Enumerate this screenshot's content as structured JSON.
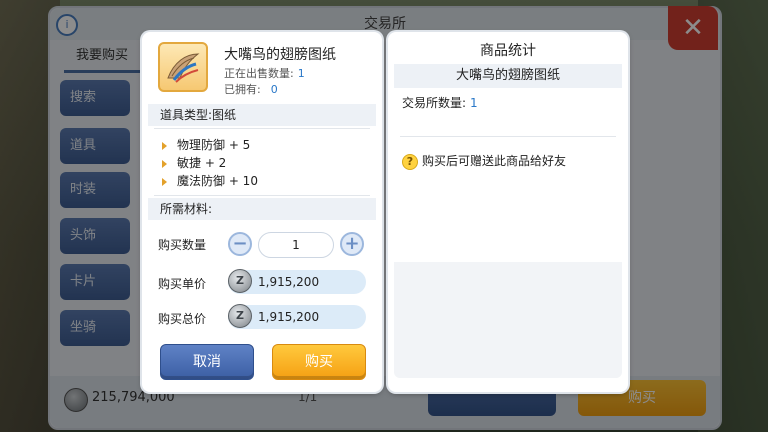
{
  "background": {
    "window_title": "交易所",
    "info_icon": "i",
    "tab_label": "我要购买",
    "side_buttons": [
      "搜索",
      "道具",
      "时装",
      "头饰",
      "卡片",
      "坐骑"
    ],
    "money": "215,794,000",
    "page": "1/1",
    "buy_label": "购买",
    "close_label": "✕"
  },
  "item": {
    "name": "大嘴鸟的翅膀图纸",
    "on_sale_label": "正在出售数量:",
    "on_sale_value": "1",
    "owned_label": "已拥有:",
    "owned_value": "0",
    "type_label": "道具类型:图纸",
    "attributes": [
      "物理防御 + 5",
      "敏捷 + 2",
      "魔法防御 + 10"
    ],
    "materials_label": "所需材料:"
  },
  "purchase": {
    "qty_label": "购买数量",
    "qty_value": "1",
    "unit_price_label": "购买单价",
    "unit_price": "1,915,200",
    "total_price_label": "购买总价",
    "total_price": "1,915,200",
    "coin_glyph": "Z",
    "cancel_label": "取消",
    "buy_label": "购买"
  },
  "stats": {
    "title": "商品统计",
    "item_name": "大嘴鸟的翅膀图纸",
    "qty_label": "交易所数量:",
    "qty_value": "1",
    "gift_hint": "购买后可赠送此商品给好友",
    "hint_icon": "?"
  }
}
